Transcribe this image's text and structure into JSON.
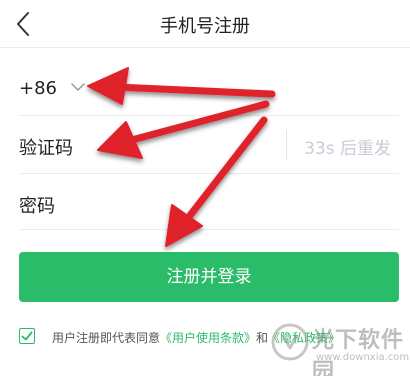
{
  "header": {
    "title": "手机号注册",
    "back_icon": "chevron-left-icon"
  },
  "form": {
    "country_code": "+86",
    "country_chevron_icon": "chevron-down-icon",
    "code_label": "验证码",
    "resend_label": "33s 后重发",
    "password_label": "密码"
  },
  "submit": {
    "label": "注册并登录"
  },
  "agreement": {
    "checked": true,
    "prefix": "用户注册即代表同意",
    "terms_link": "《用户使用条款》",
    "conjunction": "和",
    "privacy_link": "《隐私政策》"
  },
  "watermark": {
    "brand": "光下软件园",
    "url": "www.downxia.com"
  },
  "colors": {
    "accent": "#2bbc6a",
    "arrow": "#e0202a",
    "disabled_text": "#c9ccd6",
    "divider": "#ececec"
  }
}
